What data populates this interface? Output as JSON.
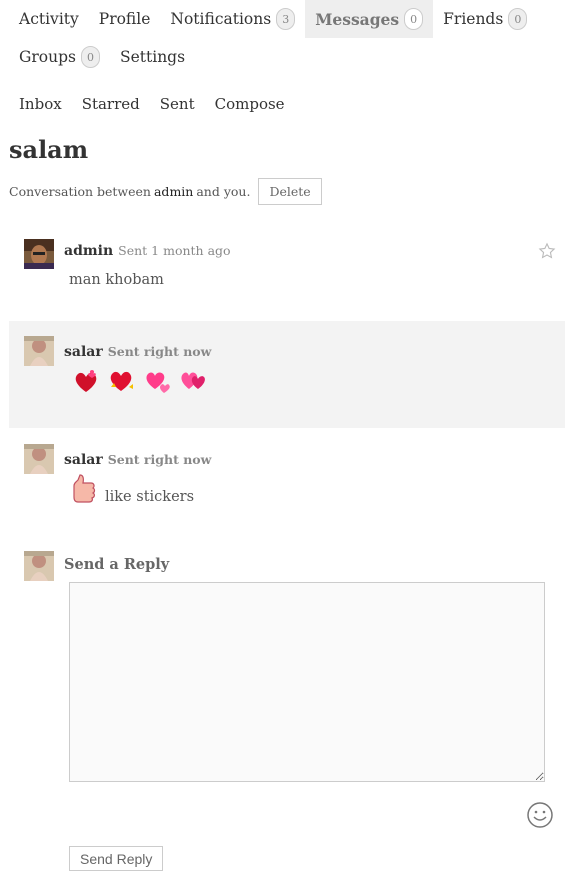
{
  "main_nav": {
    "row1": [
      {
        "label": "Activity",
        "badge": null
      },
      {
        "label": "Profile",
        "badge": null
      },
      {
        "label": "Notifications",
        "badge": "3"
      },
      {
        "label": "Messages",
        "badge": "0",
        "active": true
      },
      {
        "label": "Friends",
        "badge": "0"
      }
    ],
    "row2": [
      {
        "label": "Groups",
        "badge": "0"
      },
      {
        "label": "Settings",
        "badge": null
      }
    ]
  },
  "sub_nav": [
    "Inbox",
    "Starred",
    "Sent",
    "Compose"
  ],
  "thread": {
    "title": "salam",
    "meta_prefix": "Conversation between",
    "meta_user": "admin",
    "meta_suffix": "and you.",
    "delete_label": "Delete"
  },
  "messages": [
    {
      "author": "admin",
      "when": "Sent 1 month ago",
      "body": "man khobam",
      "avatar_icon": "admin-avatar"
    },
    {
      "author": "salar",
      "when": "Sent right now",
      "body": "",
      "stickers": [
        "heart-sticker",
        "heart-sticker",
        "heart-sticker",
        "heart-sticker"
      ],
      "avatar_icon": "salar-avatar"
    },
    {
      "author": "salar",
      "when": "Sent right now",
      "body": "like stickers",
      "stickers": [
        "thumbs-up-sticker"
      ],
      "avatar_icon": "salar-avatar"
    }
  ],
  "reply": {
    "heading": "Send a Reply",
    "textarea_value": "",
    "send_label": "Send Reply"
  },
  "colors": {
    "active_tab_bg": "#eeeeee",
    "alt_row_bg": "#f3f3f3",
    "heart_red": "#e0245e"
  }
}
